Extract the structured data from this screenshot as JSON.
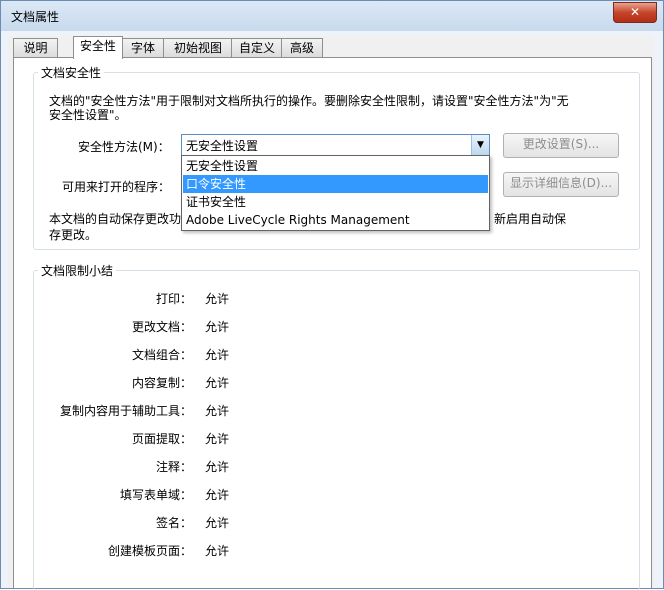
{
  "window": {
    "title": "文档属性",
    "close_glyph": "✕"
  },
  "tabs": [
    {
      "label": "说明"
    },
    {
      "label": "安全性"
    },
    {
      "label": "字体"
    },
    {
      "label": "初始视图"
    },
    {
      "label": "自定义"
    },
    {
      "label": "高级"
    }
  ],
  "security": {
    "group_title": "文档安全性",
    "description_line1": "文档的\"安全性方法\"用于限制对文档所执行的操作。要删除安全性限制，请设置\"安全性方法\"为\"无",
    "description_line2": "安全性设置\"。",
    "method_label": "安全性方法(M)：",
    "method_value": "无安全性设置",
    "method_options": [
      "无安全性设置",
      "口令安全性",
      "证书安全性",
      "Adobe LiveCycle Rights Management"
    ],
    "open_with_label": "可用来打开的程序：",
    "change_settings_button": "更改设置(S)...",
    "show_details_button": "显示详细信息(D)...",
    "autosave_line1_left": "本文档的自动保存更改功",
    "autosave_line1_right": "新启用自动保",
    "autosave_line2": "存更改。"
  },
  "summary": {
    "group_title": "文档限制小结",
    "rows": [
      {
        "label": "打印：",
        "value": "允许"
      },
      {
        "label": "更改文档：",
        "value": "允许"
      },
      {
        "label": "文档组合：",
        "value": "允许"
      },
      {
        "label": "内容复制：",
        "value": "允许"
      },
      {
        "label": "复制内容用于辅助工具：",
        "value": "允许"
      },
      {
        "label": "页面提取：",
        "value": "允许"
      },
      {
        "label": "注释：",
        "value": "允许"
      },
      {
        "label": "填写表单域：",
        "value": "允许"
      },
      {
        "label": "签名：",
        "value": "允许"
      },
      {
        "label": "创建模板页面：",
        "value": "允许"
      }
    ]
  }
}
